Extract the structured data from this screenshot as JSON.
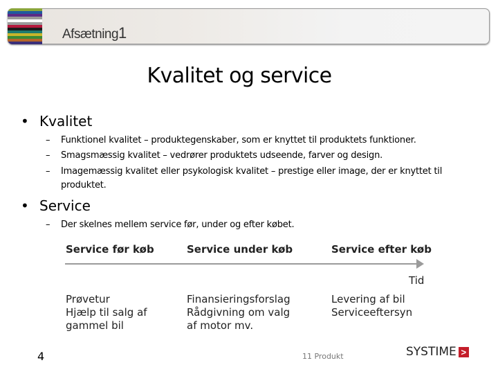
{
  "header": {
    "course_name": "Afsætning",
    "course_number": "1",
    "stripe_colors": [
      "#8aa63a",
      "#1f5a9e",
      "#5b2a86",
      "#9a9a9a",
      "#ffffff",
      "#9a9a9a",
      "#b5173c",
      "#1a1a1a",
      "#1f7a6e",
      "#c9b52a",
      "#3c8a34",
      "#b5652a",
      "#3a2f7a"
    ]
  },
  "slide": {
    "title": "Kvalitet og service",
    "bullets": [
      {
        "marker": "•",
        "label": "Kvalitet",
        "subitems": [
          {
            "marker": "–",
            "text": "Funktionel kvalitet – produktegenskaber, som er knyttet til produktets funktioner."
          },
          {
            "marker": "–",
            "text": "Smagsmæssig kvalitet – vedrører produktets udseende, farver og design."
          },
          {
            "marker": "–",
            "text": "Imagemæssig kvalitet eller psykologisk kvalitet – prestige eller image, der er knyttet til produktet."
          }
        ]
      },
      {
        "marker": "•",
        "label": "Service",
        "subitems": [
          {
            "marker": "–",
            "text": "Der skelnes mellem service før, under og efter købet."
          }
        ]
      }
    ]
  },
  "timeline": {
    "axis_label": "Tid",
    "phases": [
      {
        "heading": "Service før køb",
        "items": [
          "Prøvetur",
          "Hjælp til salg af",
          "gammel bil"
        ]
      },
      {
        "heading": "Service under køb",
        "items": [
          "Finansieringsforslag",
          "Rådgivning om valg",
          "af motor mv."
        ]
      },
      {
        "heading": "Service efter køb",
        "items": [
          "Levering af bil",
          "Serviceeftersyn"
        ]
      }
    ]
  },
  "footer": {
    "page_number": "4",
    "chapter": "11 Produkt",
    "publisher": "SYSTIME",
    "publisher_mark": ">",
    "brand_color": "#c41e2a"
  }
}
